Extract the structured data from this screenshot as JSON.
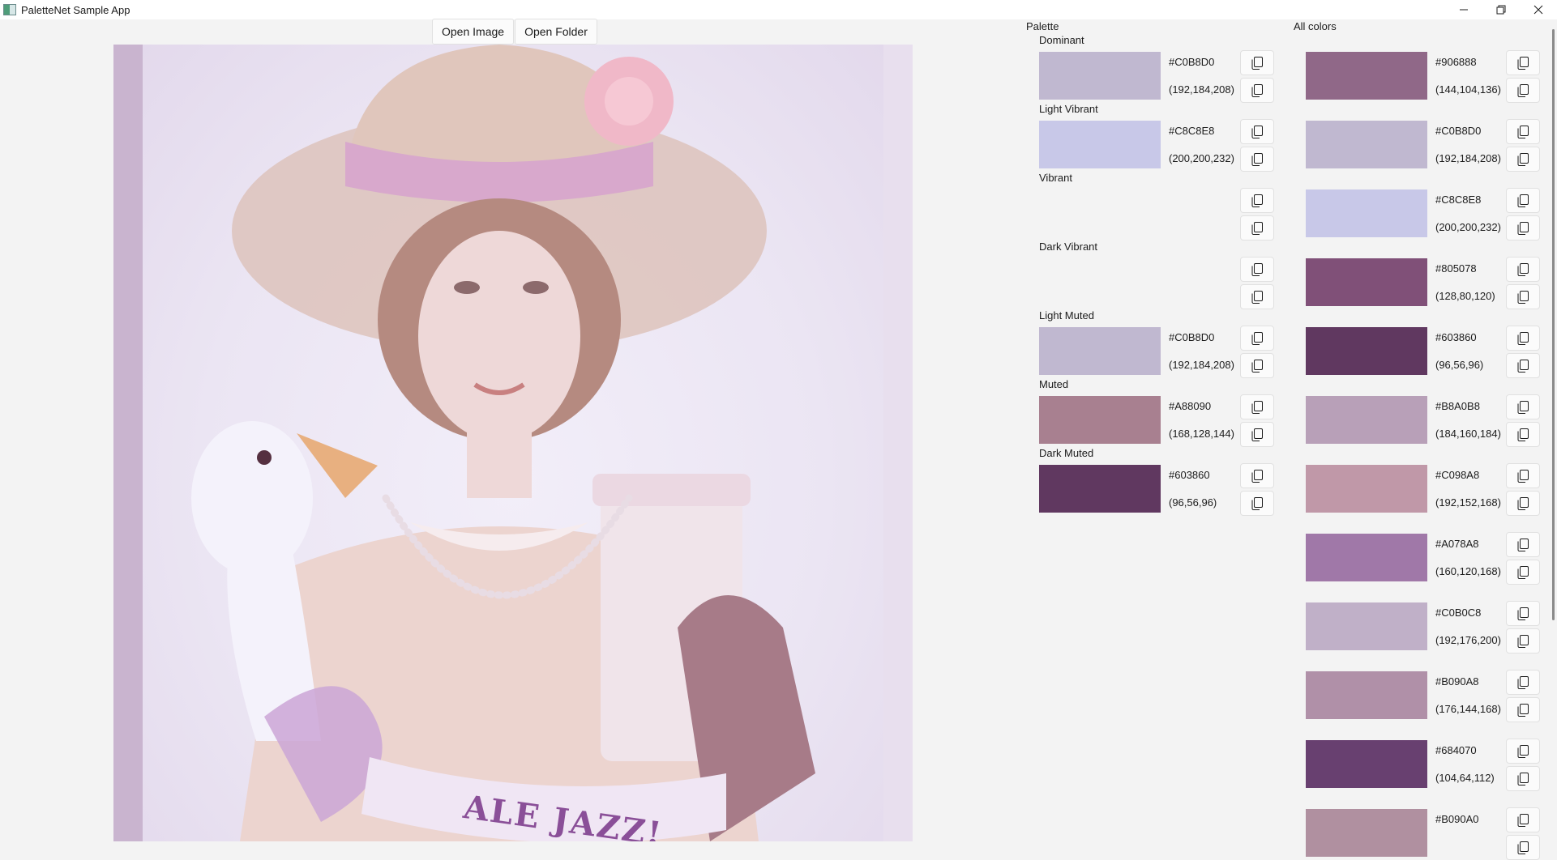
{
  "window": {
    "title": "PaletteNet Sample App",
    "minimize_icon": "minimize-icon",
    "maximize_icon": "restore-icon",
    "close_icon": "close-icon"
  },
  "toolbar": {
    "open_image_label": "Open Image",
    "open_folder_label": "Open Folder"
  },
  "image": {
    "visible_text": "ALE JAZZ!"
  },
  "palette": {
    "title": "Palette",
    "groups": [
      {
        "label": "Dominant",
        "hex": "#C0B8D0",
        "rgb": "(192,184,208)",
        "color": "#C0B8D0"
      },
      {
        "label": "Light Vibrant",
        "hex": "#C8C8E8",
        "rgb": "(200,200,232)",
        "color": "#C8C8E8"
      },
      {
        "label": "Vibrant",
        "hex": "",
        "rgb": "",
        "color": ""
      },
      {
        "label": "Dark Vibrant",
        "hex": "",
        "rgb": "",
        "color": ""
      },
      {
        "label": "Light Muted",
        "hex": "#C0B8D0",
        "rgb": "(192,184,208)",
        "color": "#C0B8D0"
      },
      {
        "label": "Muted",
        "hex": "#A88090",
        "rgb": "(168,128,144)",
        "color": "#A88090"
      },
      {
        "label": "Dark Muted",
        "hex": "#603860",
        "rgb": "(96,56,96)",
        "color": "#603860"
      }
    ]
  },
  "all_colors": {
    "title": "All colors",
    "items": [
      {
        "hex": "#906888",
        "rgb": "(144,104,136)",
        "color": "#906888"
      },
      {
        "hex": "#C0B8D0",
        "rgb": "(192,184,208)",
        "color": "#C0B8D0"
      },
      {
        "hex": "#C8C8E8",
        "rgb": "(200,200,232)",
        "color": "#C8C8E8"
      },
      {
        "hex": "#805078",
        "rgb": "(128,80,120)",
        "color": "#805078"
      },
      {
        "hex": "#603860",
        "rgb": "(96,56,96)",
        "color": "#603860"
      },
      {
        "hex": "#B8A0B8",
        "rgb": "(184,160,184)",
        "color": "#B8A0B8"
      },
      {
        "hex": "#C098A8",
        "rgb": "(192,152,168)",
        "color": "#C098A8"
      },
      {
        "hex": "#A078A8",
        "rgb": "(160,120,168)",
        "color": "#A078A8"
      },
      {
        "hex": "#C0B0C8",
        "rgb": "(192,176,200)",
        "color": "#C0B0C8"
      },
      {
        "hex": "#B090A8",
        "rgb": "(176,144,168)",
        "color": "#B090A8"
      },
      {
        "hex": "#684070",
        "rgb": "(104,64,112)",
        "color": "#684070"
      },
      {
        "hex": "#B090A0",
        "rgb": "",
        "color": "#B090A0"
      }
    ]
  },
  "copy_icon": "copy-icon"
}
